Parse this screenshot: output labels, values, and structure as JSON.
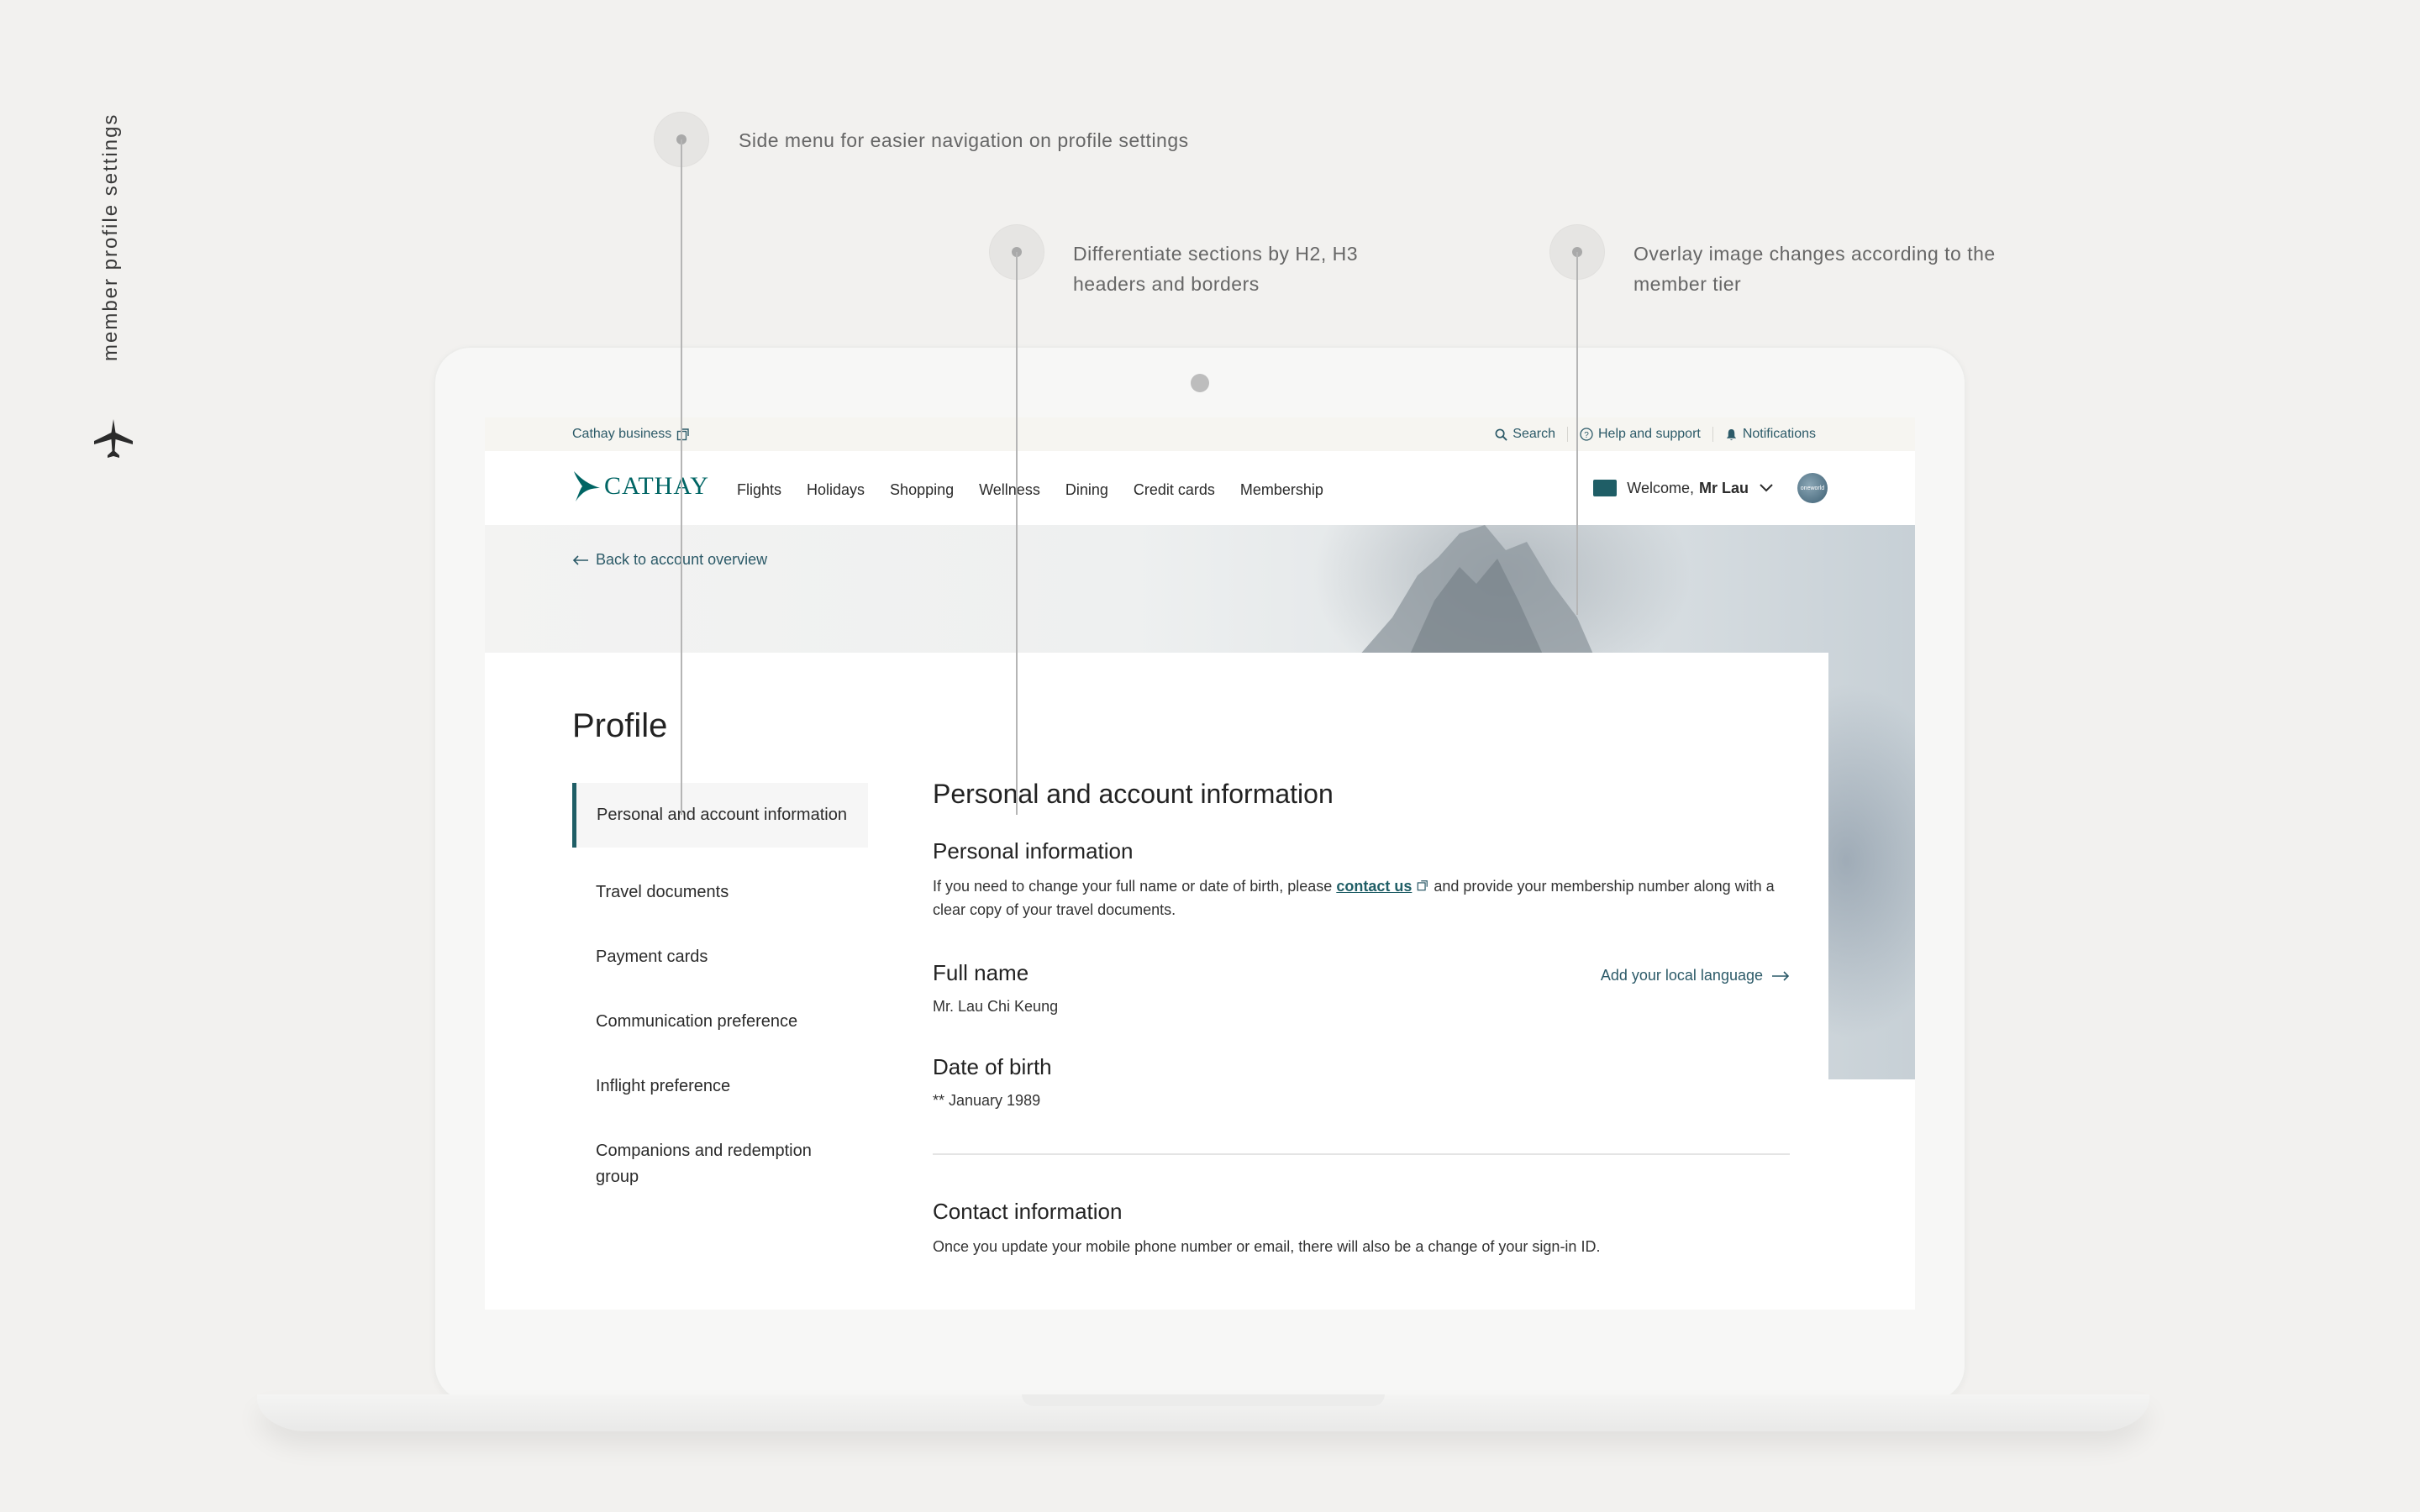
{
  "presentation": {
    "side_caption": "member profile settings",
    "callouts": [
      {
        "text": "Side menu for easier navigation on profile settings"
      },
      {
        "text": "Differentiate sections by H2, H3 headers and borders"
      },
      {
        "text": "Overlay image changes according to the member tier"
      }
    ]
  },
  "utility_bar": {
    "business_link": "Cathay business",
    "search": "Search",
    "help": "Help and support",
    "notifications": "Notifications"
  },
  "nav": {
    "logo": "CATHAY",
    "links": [
      "Flights",
      "Holidays",
      "Shopping",
      "Wellness",
      "Dining",
      "Credit cards",
      "Membership"
    ],
    "welcome_prefix": "Welcome,",
    "user_name": "Mr Lau",
    "avatar_badge": "oneworld"
  },
  "hero": {
    "back_link": "Back to account overview"
  },
  "profile": {
    "title": "Profile",
    "menu": [
      "Personal and account information",
      "Travel documents",
      "Payment cards",
      "Communication preference",
      "Inflight preference",
      "Companions and redemption group"
    ],
    "section_title": "Personal and account information",
    "personal": {
      "heading": "Personal information",
      "text_before": "If you need to change your full name or date of birth, please",
      "contact_link": "contact us",
      "text_after": "and provide your membership number along with a clear copy of your travel documents."
    },
    "full_name": {
      "label": "Full name",
      "value": "Mr. Lau Chi Keung",
      "action": "Add your local language"
    },
    "dob": {
      "label": "Date of birth",
      "value": "** January 1989"
    },
    "contact": {
      "heading": "Contact information",
      "text": "Once you update your mobile phone number or email, there will also be a change of your sign-in ID."
    }
  },
  "colors": {
    "brand": "#006564",
    "link": "#2c5a68",
    "background": "#f2f1ef"
  }
}
